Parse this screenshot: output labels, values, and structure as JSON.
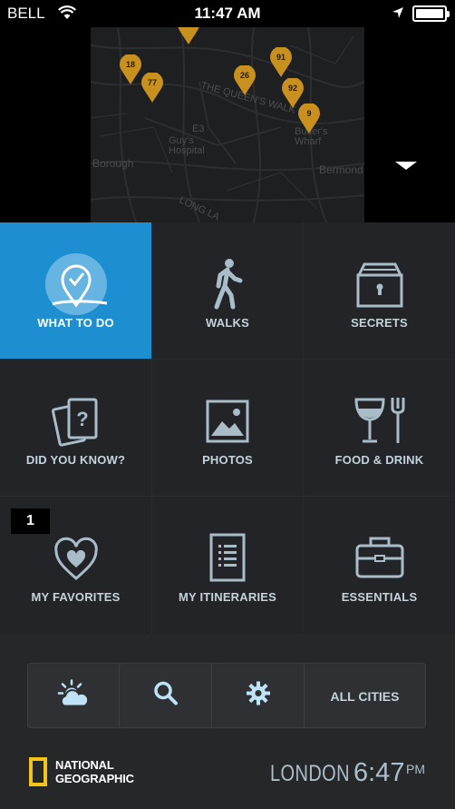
{
  "status_bar": {
    "carrier": "BELL",
    "time": "11:47 AM",
    "wifi_icon": "wifi-icon",
    "location_icon": "location-arrow-icon",
    "battery_icon": "battery-full-icon"
  },
  "map": {
    "labels": [
      "THE QUEEN'S WALK",
      "Guy's Hospital",
      "Borough",
      "Bermond",
      "Butler's Wharf",
      "LONG LA",
      "E3"
    ],
    "pins": [
      "18",
      "77",
      "26",
      "91",
      "92",
      "9"
    ],
    "pin_color": "#c8901e",
    "expand_icon": "chevron-down-icon"
  },
  "grid": {
    "active_color": "#1d8fd1",
    "tiles": [
      {
        "label": "WHAT TO DO",
        "icon": "map-pin-check-icon"
      },
      {
        "label": "WALKS",
        "icon": "walking-person-icon"
      },
      {
        "label": "SECRETS",
        "icon": "lockbox-icon"
      },
      {
        "label": "DID YOU KNOW?",
        "icon": "question-cards-icon"
      },
      {
        "label": "PHOTOS",
        "icon": "photo-icon"
      },
      {
        "label": "FOOD & DRINK",
        "icon": "wine-fork-icon"
      },
      {
        "label": "MY FAVORITES",
        "icon": "heart-icon",
        "badge": "1"
      },
      {
        "label": "MY ITINERARIES",
        "icon": "document-list-icon"
      },
      {
        "label": "ESSENTIALS",
        "icon": "suitcase-icon"
      }
    ]
  },
  "toolbar": {
    "weather_icon": "weather-sun-cloud-icon",
    "search_icon": "search-icon",
    "settings_icon": "gear-icon",
    "all_cities_label": "ALL CITIES"
  },
  "footer": {
    "brand_line1": "NATIONAL",
    "brand_line2": "GEOGRAPHIC",
    "city": "LONDON",
    "local_time": "6:47",
    "ampm": "PM",
    "brand_yellow": "#f3c318"
  }
}
